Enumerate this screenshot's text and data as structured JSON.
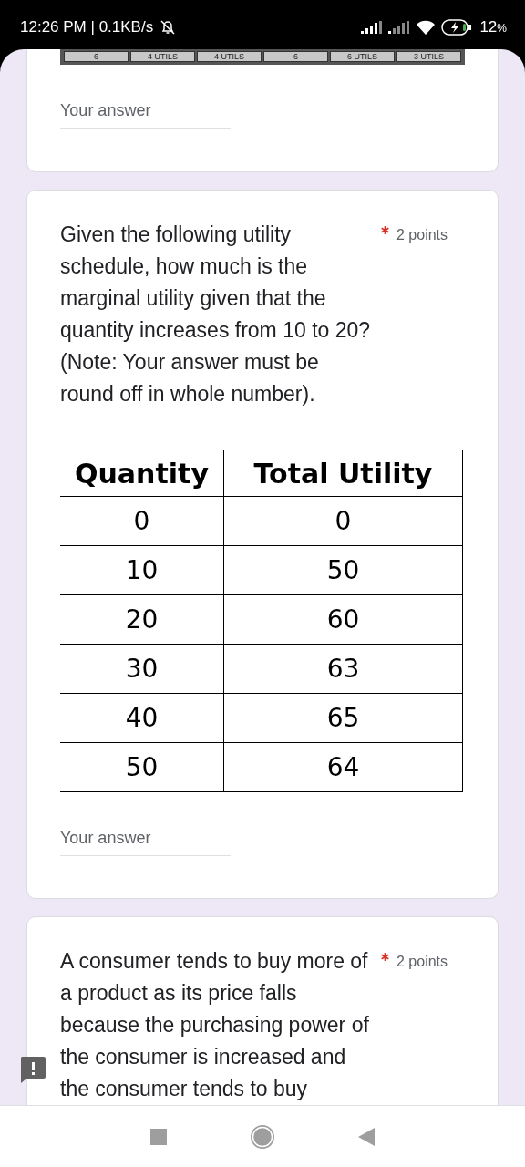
{
  "status_bar": {
    "time": "12:26 PM | 0.1KB/s",
    "battery": "12",
    "battery_unit": "%"
  },
  "questions": [
    {
      "kind": "partial",
      "strip_cells": [
        "6",
        "4 UTILS",
        "4 UTILS",
        "6",
        "6 UTILS",
        "3 UTILS"
      ],
      "answer_placeholder": "Your answer"
    },
    {
      "kind": "table",
      "title": "Given the following utility schedule, how much is the marginal utility given that the quantity increases from 10 to 20? (Note: Your answer must be round off in whole number).",
      "required": true,
      "points": "2 points",
      "table": {
        "columns": [
          "Quantity",
          "Total Utility"
        ],
        "rows": [
          [
            "0",
            "0"
          ],
          [
            "10",
            "50"
          ],
          [
            "20",
            "60"
          ],
          [
            "30",
            "63"
          ],
          [
            "40",
            "65"
          ],
          [
            "50",
            "64"
          ]
        ]
      },
      "answer_placeholder": "Your answer"
    },
    {
      "kind": "text",
      "title": "A consumer tends to buy more of a product as its price falls because the purchasing power of the consumer is increased and the consumer tends to buy",
      "required": true,
      "points": "2 points"
    }
  ]
}
